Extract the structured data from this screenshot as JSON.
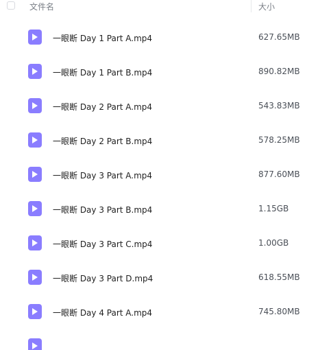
{
  "header": {
    "name_label": "文件名",
    "size_label": "大小"
  },
  "files": [
    {
      "name": "一眼断 Day 1 Part A.mp4",
      "size": "627.65MB"
    },
    {
      "name": "一眼断 Day 1 Part B.mp4",
      "size": "890.82MB"
    },
    {
      "name": "一眼断 Day 2 Part A.mp4",
      "size": "543.83MB"
    },
    {
      "name": "一眼断 Day 2 Part B.mp4",
      "size": "578.25MB"
    },
    {
      "name": "一眼断 Day 3 Part A.mp4",
      "size": "877.60MB"
    },
    {
      "name": "一眼断 Day 3 Part B.mp4",
      "size": "1.15GB"
    },
    {
      "name": "一眼断 Day 3 Part C.mp4",
      "size": "1.00GB"
    },
    {
      "name": "一眼断 Day 3 Part D.mp4",
      "size": "618.55MB"
    },
    {
      "name": "一眼断 Day 4 Part A.mp4",
      "size": "745.80MB"
    }
  ],
  "colors": {
    "video_icon": "#8a7dff",
    "header_text": "#7a7f87"
  },
  "icons": {
    "file_type": "video-file-icon"
  }
}
